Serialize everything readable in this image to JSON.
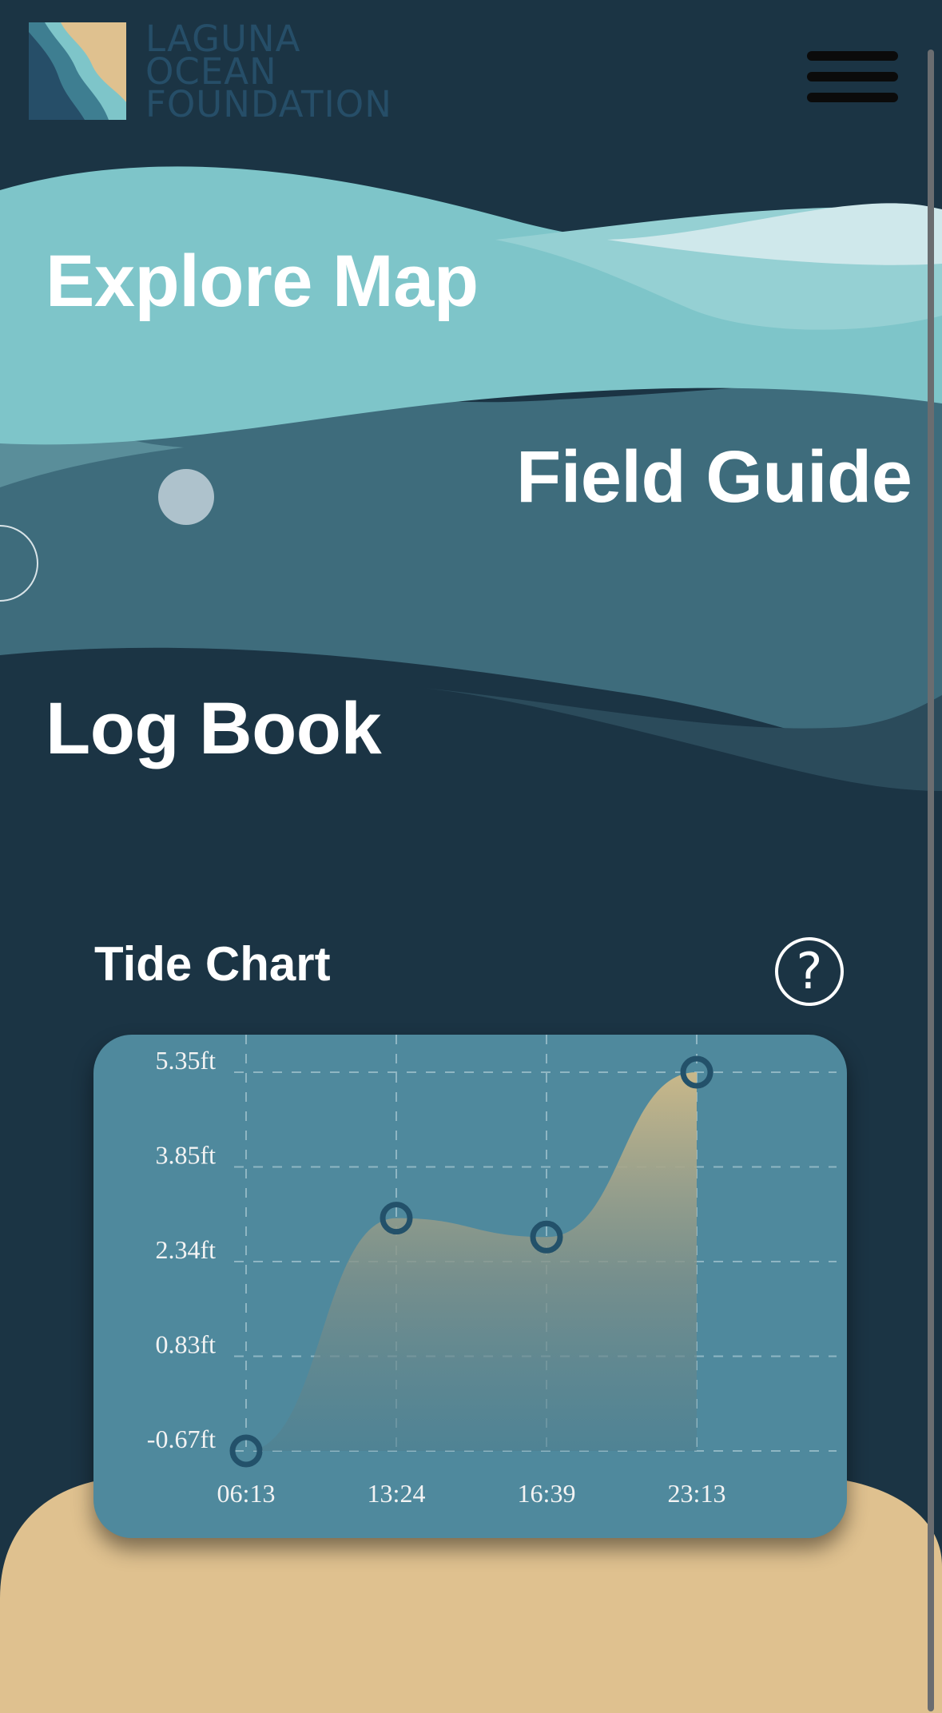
{
  "header": {
    "logo_lines": [
      "LAGUNA",
      "OCEAN",
      "FOUNDATION"
    ]
  },
  "nav": {
    "explore_map": "Explore Map",
    "field_guide": "Field Guide",
    "log_book": "Log Book"
  },
  "icons": {
    "menu": "hamburger-menu-icon",
    "help": "question-mark-icon"
  },
  "colors": {
    "light_teal": "#7ec5c9",
    "mid_teal": "#3e6c7c",
    "deep_navy": "#1b3444",
    "sand": "#dfc18f",
    "chart_card": "#4f899d",
    "point_stroke": "#23516a"
  },
  "tide_chart": {
    "title": "Tide Chart",
    "help_symbol": "?"
  },
  "chart_data": {
    "type": "area",
    "x": [
      "06:13",
      "13:24",
      "16:39",
      "23:13"
    ],
    "y": [
      -0.67,
      3.03,
      2.73,
      5.35
    ],
    "y_unit": "ft",
    "y_ticks": [
      "-0.67ft",
      "0.83ft",
      "2.34ft",
      "3.85ft",
      "5.35ft"
    ],
    "x_ticks": [
      "06:13",
      "13:24",
      "16:39",
      "23:13"
    ],
    "ylim": [
      -0.67,
      5.35
    ],
    "grid": true,
    "title": "",
    "xlabel": "",
    "ylabel": ""
  }
}
